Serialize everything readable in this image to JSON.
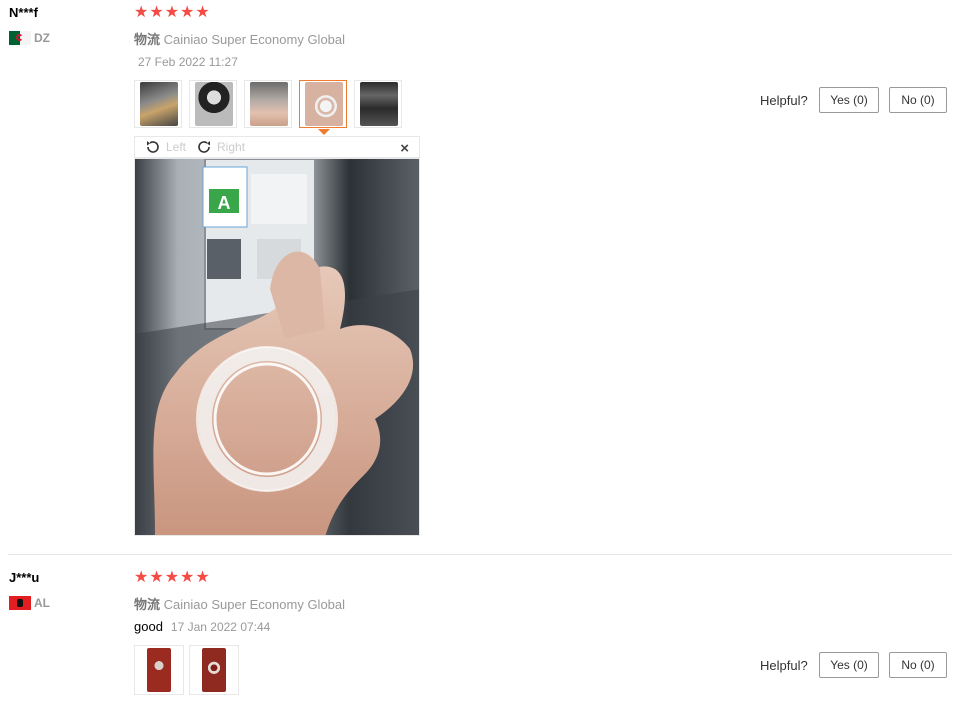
{
  "reviews": [
    {
      "username": "N***f",
      "country": "DZ",
      "rating": 5,
      "logistics_prefix": "物流",
      "logistics": "Cainiao Super Economy Global",
      "comment": "",
      "date": "27 Feb 2022 11:27",
      "helpful_label": "Helpful?",
      "yes_label": "Yes (0)",
      "no_label": "No (0)",
      "viewer": {
        "left_label": "Left",
        "right_label": "Right",
        "close_label": "×"
      }
    },
    {
      "username": "J***u",
      "country": "AL",
      "rating": 5,
      "logistics_prefix": "物流",
      "logistics": "Cainiao Super Economy Global",
      "comment": "good",
      "date": "17 Jan 2022 07:44",
      "helpful_label": "Helpful?",
      "yes_label": "Yes (0)",
      "no_label": "No (0)"
    }
  ],
  "colors": {
    "star": "#f44b45",
    "active_thumb_border": "#f07c33"
  }
}
